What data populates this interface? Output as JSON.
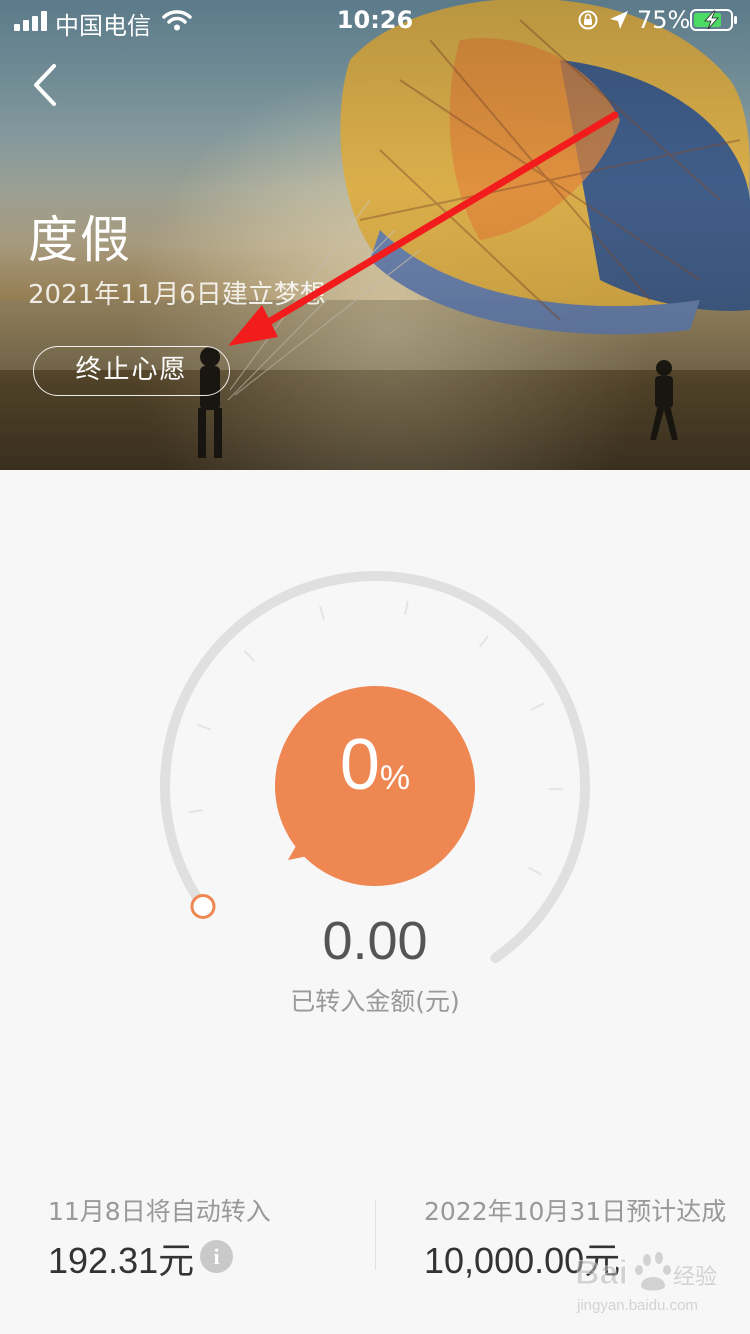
{
  "status_bar": {
    "carrier": "中国电信",
    "time": "10:26",
    "battery": "75%"
  },
  "hero": {
    "title": "度假",
    "subtitle": "2021年11月6日建立梦想",
    "end_button": "终止心愿"
  },
  "gauge": {
    "progress_percent": 0,
    "percent_value": "0",
    "percent_sign": "%",
    "amount": "0.00",
    "amount_label": "已转入金额(元)",
    "accent_color": "#ee8752",
    "track_color": "#e0e0e0"
  },
  "stats": {
    "left_label": "11月8日将自动转入",
    "left_value": "192.31元",
    "info_icon_char": "i",
    "right_label": "2022年10月31日预计达成",
    "right_value": "10,000.00元"
  },
  "watermark": {
    "brand": "Bai",
    "brand_cn": "经验",
    "url": "jingyan.baidu.com"
  },
  "icons": {
    "back": "chevron-left-icon",
    "signal": "signal-icon",
    "wifi": "wifi-icon",
    "orientation_lock": "orientation-lock-icon",
    "location": "location-arrow-icon",
    "battery": "battery-charging-icon",
    "info": "info-icon"
  }
}
